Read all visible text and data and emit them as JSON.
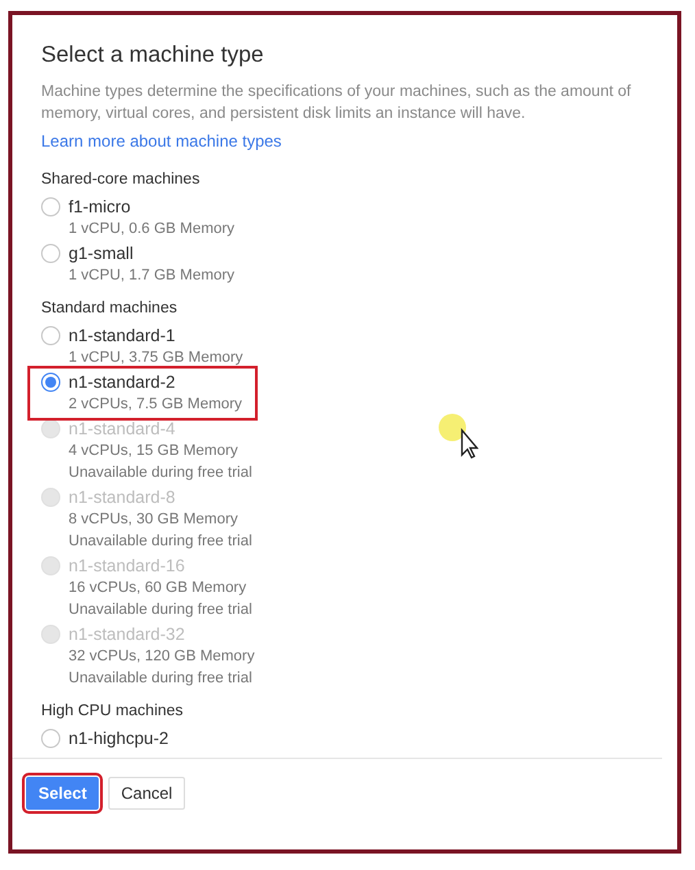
{
  "title": "Select a machine type",
  "description": "Machine types determine the specifications of your machines, such as the amount of memory, virtual cores, and persistent disk limits an instance will have.",
  "learn_more_link": "Learn more about machine types",
  "sections": [
    {
      "heading": "Shared-core machines",
      "machines": [
        {
          "name": "f1-micro",
          "specs": "1 vCPU, 0.6 GB Memory",
          "selected": false,
          "disabled": false,
          "highlighted": false
        },
        {
          "name": "g1-small",
          "specs": "1 vCPU, 1.7 GB Memory",
          "selected": false,
          "disabled": false,
          "highlighted": false
        }
      ]
    },
    {
      "heading": "Standard machines",
      "machines": [
        {
          "name": "n1-standard-1",
          "specs": "1 vCPU, 3.75 GB Memory",
          "selected": false,
          "disabled": false,
          "highlighted": false
        },
        {
          "name": "n1-standard-2",
          "specs": "2 vCPUs, 7.5 GB Memory",
          "selected": true,
          "disabled": false,
          "highlighted": true
        },
        {
          "name": "n1-standard-4",
          "specs": "4 vCPUs, 15 GB Memory",
          "note": "Unavailable during free trial",
          "selected": false,
          "disabled": true,
          "highlighted": false
        },
        {
          "name": "n1-standard-8",
          "specs": "8 vCPUs, 30 GB Memory",
          "note": "Unavailable during free trial",
          "selected": false,
          "disabled": true,
          "highlighted": false
        },
        {
          "name": "n1-standard-16",
          "specs": "16 vCPUs, 60 GB Memory",
          "note": "Unavailable during free trial",
          "selected": false,
          "disabled": true,
          "highlighted": false
        },
        {
          "name": "n1-standard-32",
          "specs": "32 vCPUs, 120 GB Memory",
          "note": "Unavailable during free trial",
          "selected": false,
          "disabled": true,
          "highlighted": false
        }
      ]
    },
    {
      "heading": "High CPU machines",
      "machines": [
        {
          "name": "n1-highcpu-2",
          "selected": false,
          "disabled": false,
          "highlighted": false
        }
      ]
    }
  ],
  "buttons": [
    {
      "label": "Select",
      "kind": "primary",
      "highlighted": true
    },
    {
      "label": "Cancel",
      "kind": "secondary",
      "highlighted": false
    }
  ]
}
